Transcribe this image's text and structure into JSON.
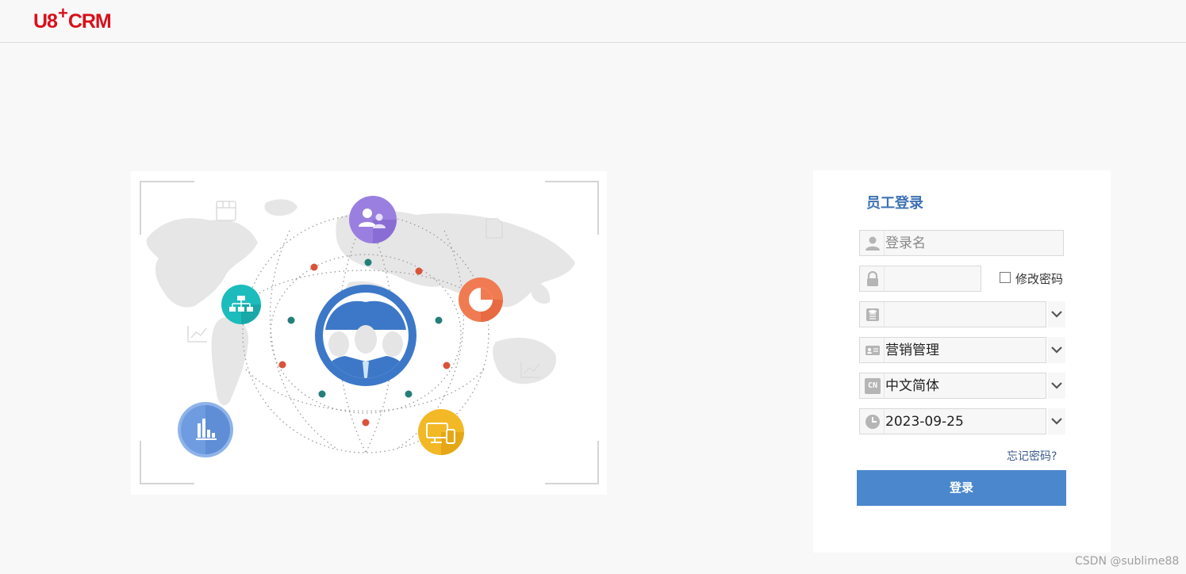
{
  "header": {
    "logo_prefix": "U8",
    "logo_plus": "+",
    "logo_suffix": "CRM"
  },
  "login": {
    "title": "员工登录",
    "username_placeholder": "登录名",
    "password_value": "",
    "change_password_label": "修改密码",
    "change_password_checked": false,
    "account_value": "",
    "module_value": "营销管理",
    "language_value": "中文简体",
    "language_icon_text": "CN",
    "date_value": "2023-09-25",
    "forgot_password_label": "忘记密码?",
    "login_button_label": "登录"
  },
  "colors": {
    "brand_red": "#d8101a",
    "accent_blue": "#4a87cc",
    "title_blue": "#3d72b4"
  },
  "watermark": "CSDN @sublime88"
}
